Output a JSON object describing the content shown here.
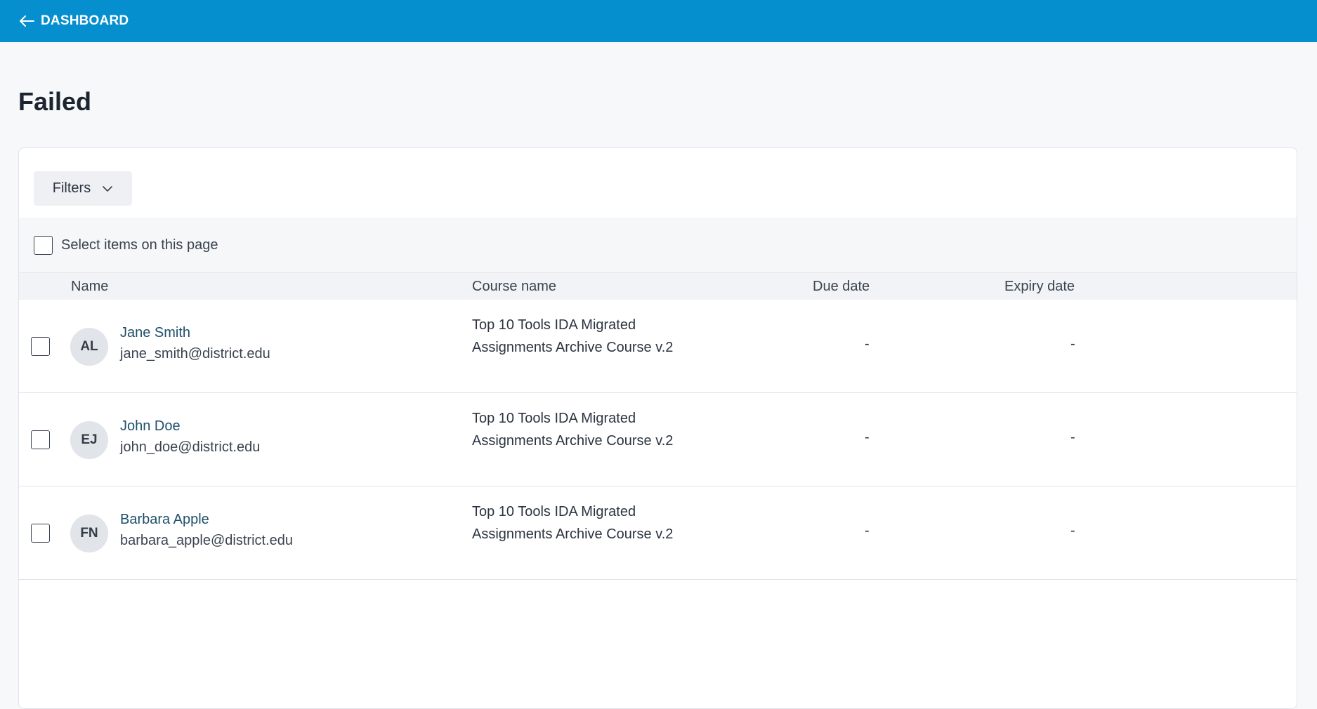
{
  "header": {
    "back_label": "DASHBOARD"
  },
  "page": {
    "title": "Failed"
  },
  "toolbar": {
    "filters_label": "Filters"
  },
  "selection": {
    "label": "Select items on this page"
  },
  "table": {
    "columns": [
      "Name",
      "Course name",
      "Due date",
      "Expiry date"
    ],
    "rows": [
      {
        "initials": "AL",
        "name": "Jane Smith",
        "email": "jane_smith@district.edu",
        "course": "Top 10 Tools IDA Migrated Assignments Archive Course v.2",
        "due": "-",
        "expiry": "-"
      },
      {
        "initials": "EJ",
        "name": "John Doe",
        "email": "john_doe@district.edu",
        "course": "Top 10 Tools IDA Migrated Assignments Archive Course v.2",
        "due": "-",
        "expiry": "-"
      },
      {
        "initials": "FN",
        "name": "Barbara Apple",
        "email": "barbara_apple@district.edu",
        "course": "Top 10 Tools IDA Migrated Assignments Archive Course v.2",
        "due": "-",
        "expiry": "-"
      }
    ]
  },
  "icons": {
    "back": "arrow-left-icon",
    "filters": "chevron-down-icon"
  },
  "colors": {
    "topbar": "#058fcf",
    "link": "#1f4f6a"
  }
}
